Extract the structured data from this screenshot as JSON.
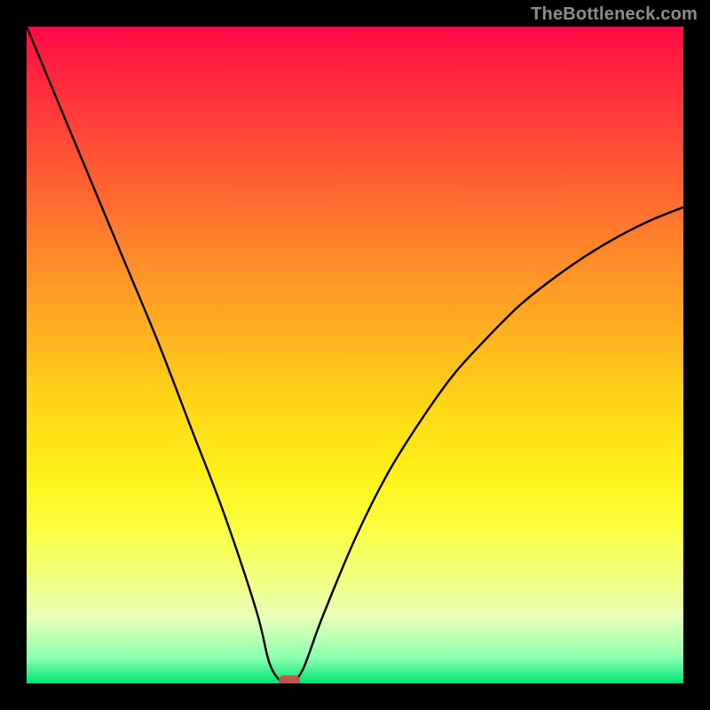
{
  "watermark": "TheBottleneck.com",
  "chart_data": {
    "type": "line",
    "title": "",
    "xlabel": "",
    "ylabel": "",
    "xlim": [
      0,
      100
    ],
    "ylim": [
      0,
      100
    ],
    "grid": false,
    "legend": false,
    "series": [
      {
        "name": "curve",
        "x": [
          0,
          5,
          10,
          15,
          20,
          25,
          30,
          35,
          37,
          39,
          40,
          42,
          45,
          50,
          55,
          60,
          65,
          70,
          75,
          80,
          85,
          90,
          95,
          100
        ],
        "y": [
          100,
          88,
          76,
          64,
          52,
          39,
          26,
          11,
          3,
          0,
          0,
          2,
          10,
          22,
          32,
          40,
          47,
          52.5,
          57.5,
          61.5,
          65,
          68,
          70.5,
          72.5
        ]
      }
    ],
    "marker": {
      "x": 40,
      "y": 0,
      "color": "#b85a4a"
    },
    "colors": {
      "gradient_top": "#ff0a46",
      "gradient_bottom": "#00e277",
      "curve": "#000000",
      "background": "#000000"
    }
  }
}
